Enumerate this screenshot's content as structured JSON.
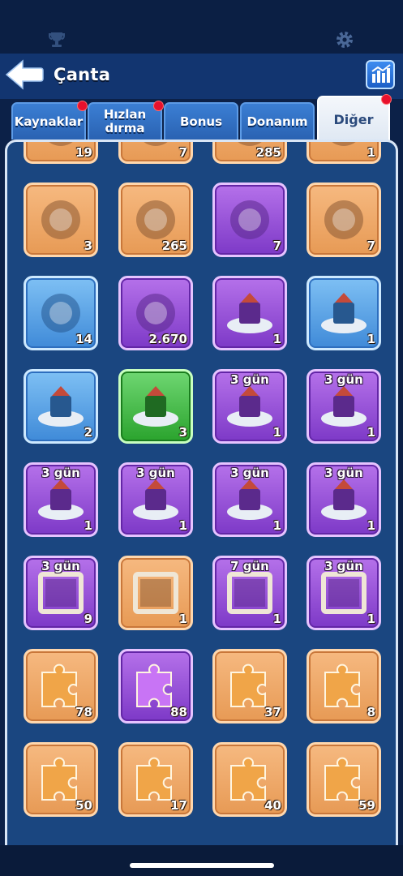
{
  "header": {
    "title": "Çanta"
  },
  "tabs": [
    {
      "label": "Kaynaklar",
      "has_dot": true
    },
    {
      "label": "Hızlan dırma",
      "has_dot": true
    },
    {
      "label": "Bonus",
      "has_dot": false
    },
    {
      "label": "Donanım",
      "has_dot": false
    },
    {
      "label": "Diğer",
      "has_dot": true,
      "active": true
    }
  ],
  "icons": {
    "trophy": "trophy-icon",
    "settings": "gear-icon",
    "back": "back-arrow-icon",
    "stats": "stats-chart-icon"
  },
  "items": [
    {
      "name": "moon-emblem",
      "color": "orange",
      "count": "19",
      "days": ""
    },
    {
      "name": "firework-rocket",
      "color": "orange",
      "count": "7",
      "days": ""
    },
    {
      "name": "shell-badge",
      "color": "orange",
      "count": "285",
      "days": ""
    },
    {
      "name": "shovel",
      "color": "orange",
      "count": "1",
      "days": ""
    },
    {
      "name": "blue-paw-ticket",
      "color": "orange",
      "count": "3",
      "days": ""
    },
    {
      "name": "paw-cookie",
      "color": "orange",
      "count": "265",
      "days": ""
    },
    {
      "name": "mystery-card",
      "color": "purple",
      "count": "7",
      "days": ""
    },
    {
      "name": "jetpack",
      "color": "orange",
      "count": "7",
      "days": ""
    },
    {
      "name": "grappling-hook",
      "color": "blue",
      "count": "14",
      "days": ""
    },
    {
      "name": "mystery-gold-badge",
      "color": "purple",
      "count": "2.670",
      "days": ""
    },
    {
      "name": "statue-base-purple",
      "color": "purple",
      "count": "1",
      "days": ""
    },
    {
      "name": "statue-base-blue",
      "color": "blue",
      "count": "1",
      "days": ""
    },
    {
      "name": "banner-base",
      "color": "blue",
      "count": "2",
      "days": ""
    },
    {
      "name": "mystery-base",
      "color": "green",
      "count": "3",
      "days": ""
    },
    {
      "name": "castle-skin-1",
      "color": "purple",
      "count": "1",
      "days": "3 gün"
    },
    {
      "name": "castle-skin-2",
      "color": "purple",
      "count": "1",
      "days": "3 gün"
    },
    {
      "name": "castle-skin-3",
      "color": "purple",
      "count": "1",
      "days": "3 gün"
    },
    {
      "name": "castle-skin-4",
      "color": "purple",
      "count": "1",
      "days": "3 gün"
    },
    {
      "name": "castle-skin-5",
      "color": "purple",
      "count": "1",
      "days": "3 gün"
    },
    {
      "name": "castle-skin-6",
      "color": "purple",
      "count": "1",
      "days": "3 gün"
    },
    {
      "name": "frame-skull",
      "color": "purple",
      "count": "9",
      "days": "3 gün"
    },
    {
      "name": "frame-ice",
      "color": "orange",
      "count": "1",
      "days": ""
    },
    {
      "name": "frame-green",
      "color": "purple",
      "count": "1",
      "days": "7 gün"
    },
    {
      "name": "frame-brown",
      "color": "purple",
      "count": "1",
      "days": "3 gün"
    },
    {
      "name": "puzzle-orange",
      "color": "orange",
      "count": "78",
      "days": ""
    },
    {
      "name": "puzzle-purple",
      "color": "purple",
      "count": "88",
      "days": ""
    },
    {
      "name": "puzzle-hero-1",
      "color": "orange",
      "count": "37",
      "days": ""
    },
    {
      "name": "puzzle-hero-2",
      "color": "orange",
      "count": "8",
      "days": ""
    },
    {
      "name": "puzzle-hero-3",
      "color": "orange",
      "count": "50",
      "days": ""
    },
    {
      "name": "puzzle-hero-4",
      "color": "orange",
      "count": "17",
      "days": ""
    },
    {
      "name": "puzzle-hero-5",
      "color": "orange",
      "count": "40",
      "days": ""
    },
    {
      "name": "puzzle-hero-6",
      "color": "orange",
      "count": "59",
      "days": ""
    }
  ],
  "colors": {
    "orange": "#e79a55",
    "purple": "#8a45d4",
    "blue": "#4f99e0",
    "green": "#2fa632",
    "badge_red": "#e8112d"
  }
}
